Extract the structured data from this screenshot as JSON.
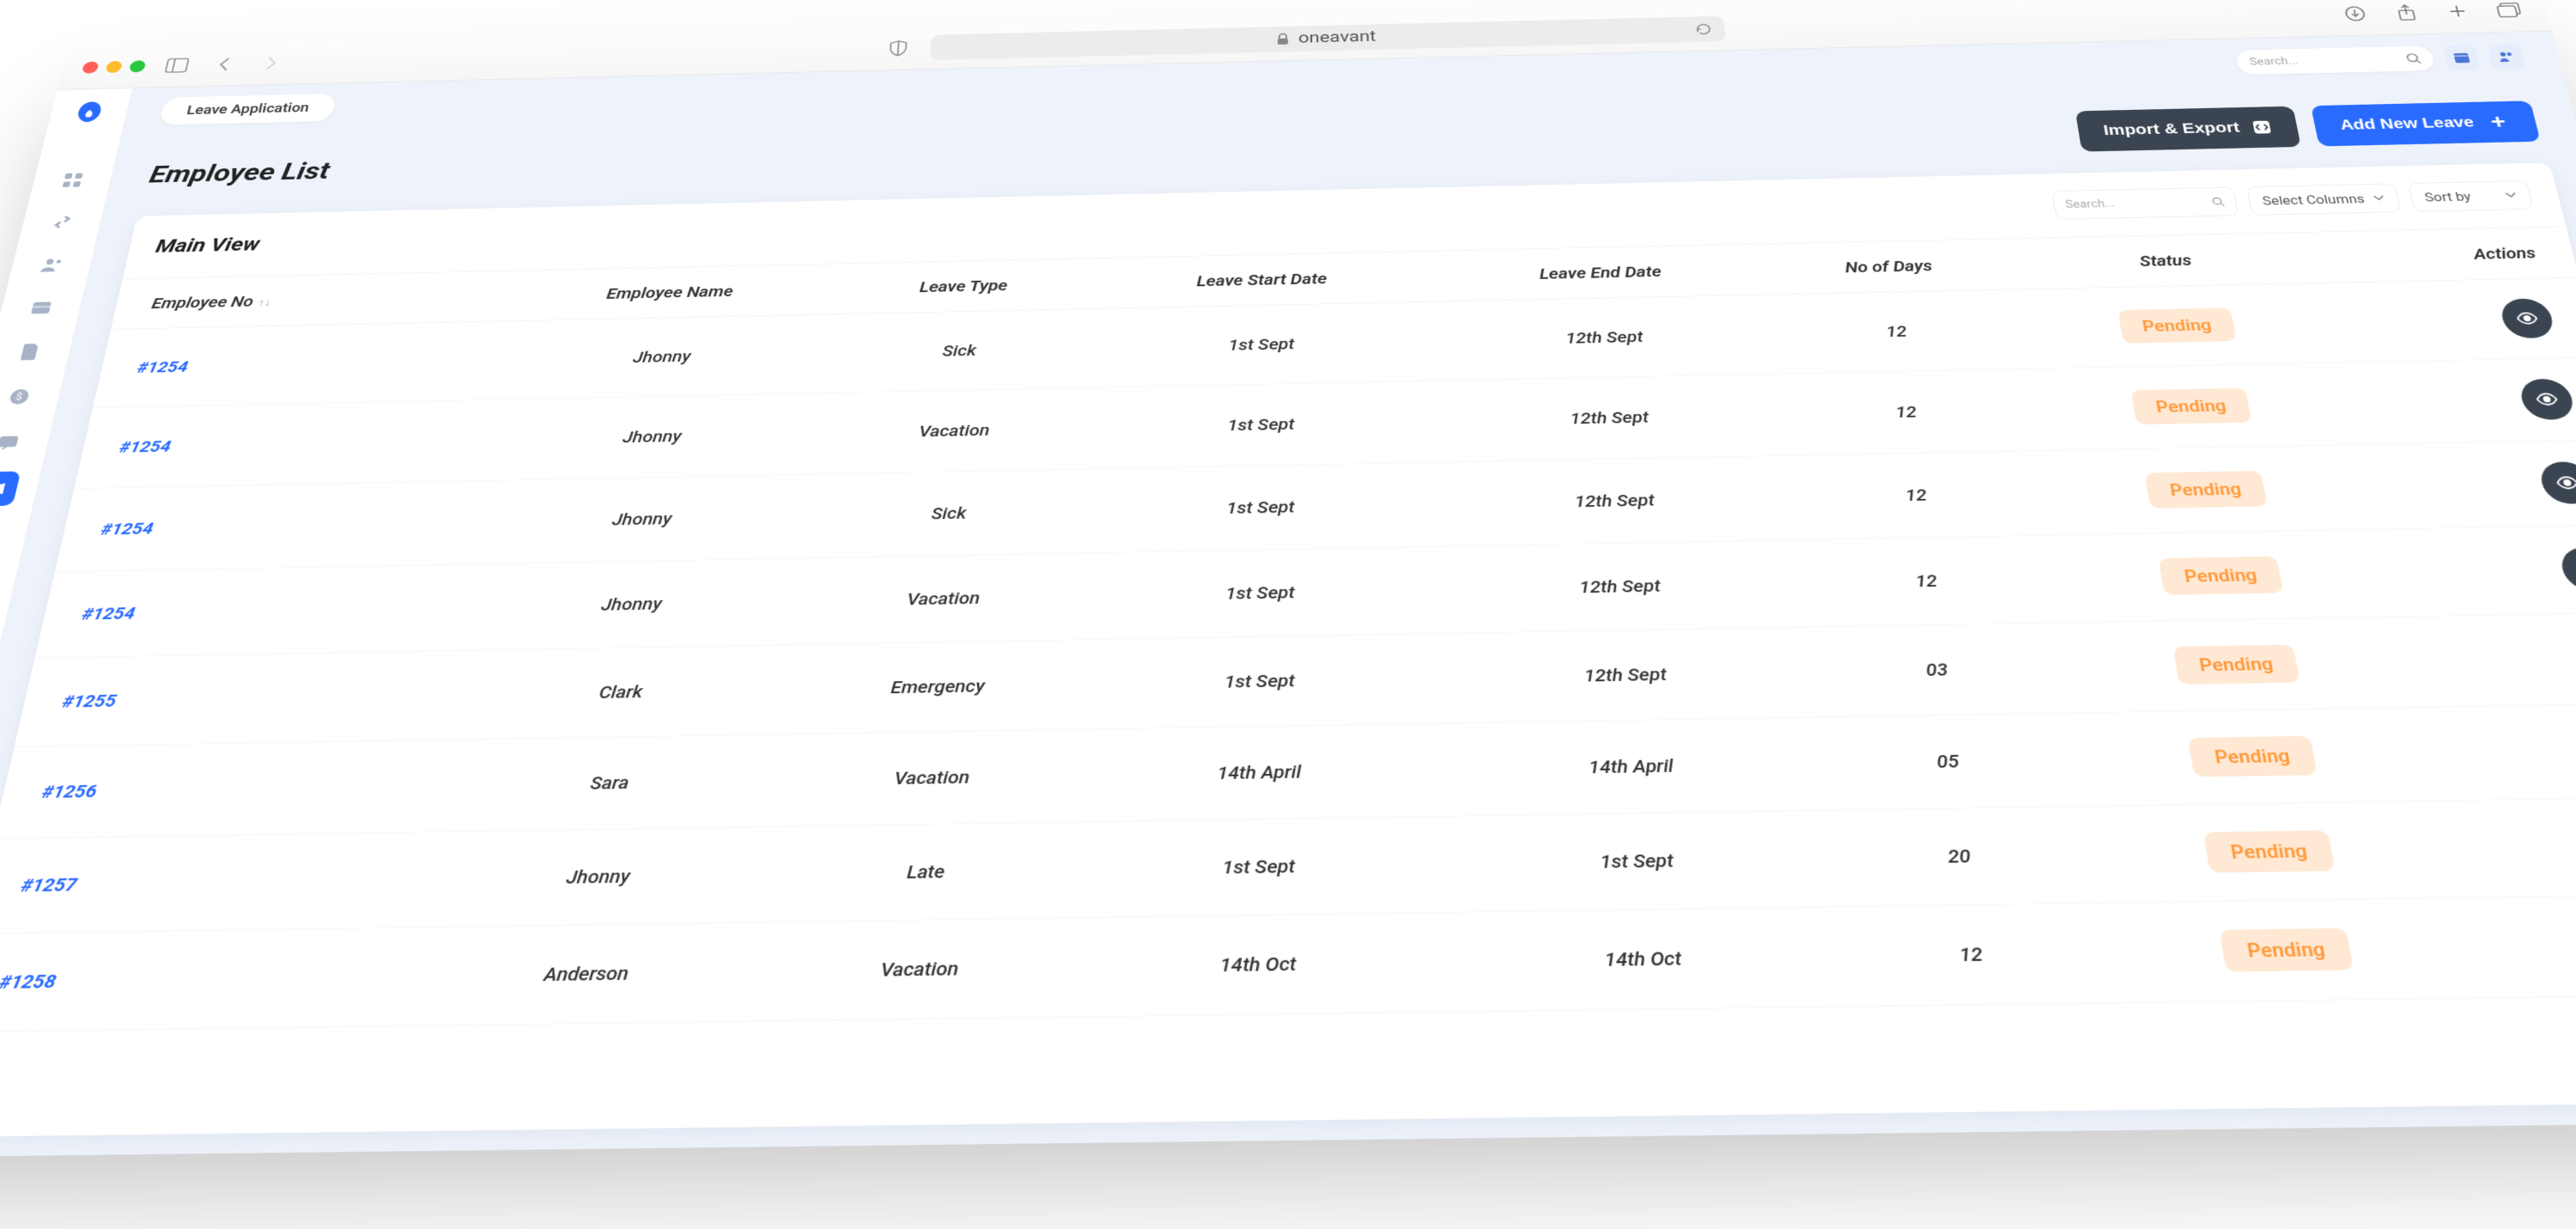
{
  "browser": {
    "address": "oneavant"
  },
  "breadcrumb": "Leave Application",
  "top_search_placeholder": "Search...",
  "page_title": "Employee List",
  "buttons": {
    "import_export": "Import & Export",
    "add_new": "Add New Leave"
  },
  "card": {
    "title": "Main View",
    "search_placeholder": "Search...",
    "select_columns": "Select Columns",
    "sort_by": "Sort by"
  },
  "columns": {
    "emp_no": "Employee No",
    "emp_name": "Employee Name",
    "leave_type": "Leave Type",
    "start": "Leave Start Date",
    "end": "Leave End Date",
    "days": "No of Days",
    "status": "Status",
    "actions": "Actions"
  },
  "rows": [
    {
      "id": "#1254",
      "name": "Jhonny",
      "type": "Sick",
      "start": "1st Sept",
      "end": "12th Sept",
      "days": "12",
      "status": "Pending"
    },
    {
      "id": "#1254",
      "name": "Jhonny",
      "type": "Vacation",
      "start": "1st Sept",
      "end": "12th Sept",
      "days": "12",
      "status": "Pending"
    },
    {
      "id": "#1254",
      "name": "Jhonny",
      "type": "Sick",
      "start": "1st Sept",
      "end": "12th Sept",
      "days": "12",
      "status": "Pending"
    },
    {
      "id": "#1254",
      "name": "Jhonny",
      "type": "Vacation",
      "start": "1st Sept",
      "end": "12th Sept",
      "days": "12",
      "status": "Pending"
    },
    {
      "id": "#1255",
      "name": "Clark",
      "type": "Emergency",
      "start": "1st Sept",
      "end": "12th Sept",
      "days": "03",
      "status": "Pending"
    },
    {
      "id": "#1256",
      "name": "Sara",
      "type": "Vacation",
      "start": "14th April",
      "end": "14th April",
      "days": "05",
      "status": "Pending"
    },
    {
      "id": "#1257",
      "name": "Jhonny",
      "type": "Late",
      "start": "1st Sept",
      "end": "1st Sept",
      "days": "20",
      "status": "Pending"
    },
    {
      "id": "#1258",
      "name": "Anderson",
      "type": "Vacation",
      "start": "14th Oct",
      "end": "14th Oct",
      "days": "12",
      "status": "Pending"
    }
  ]
}
